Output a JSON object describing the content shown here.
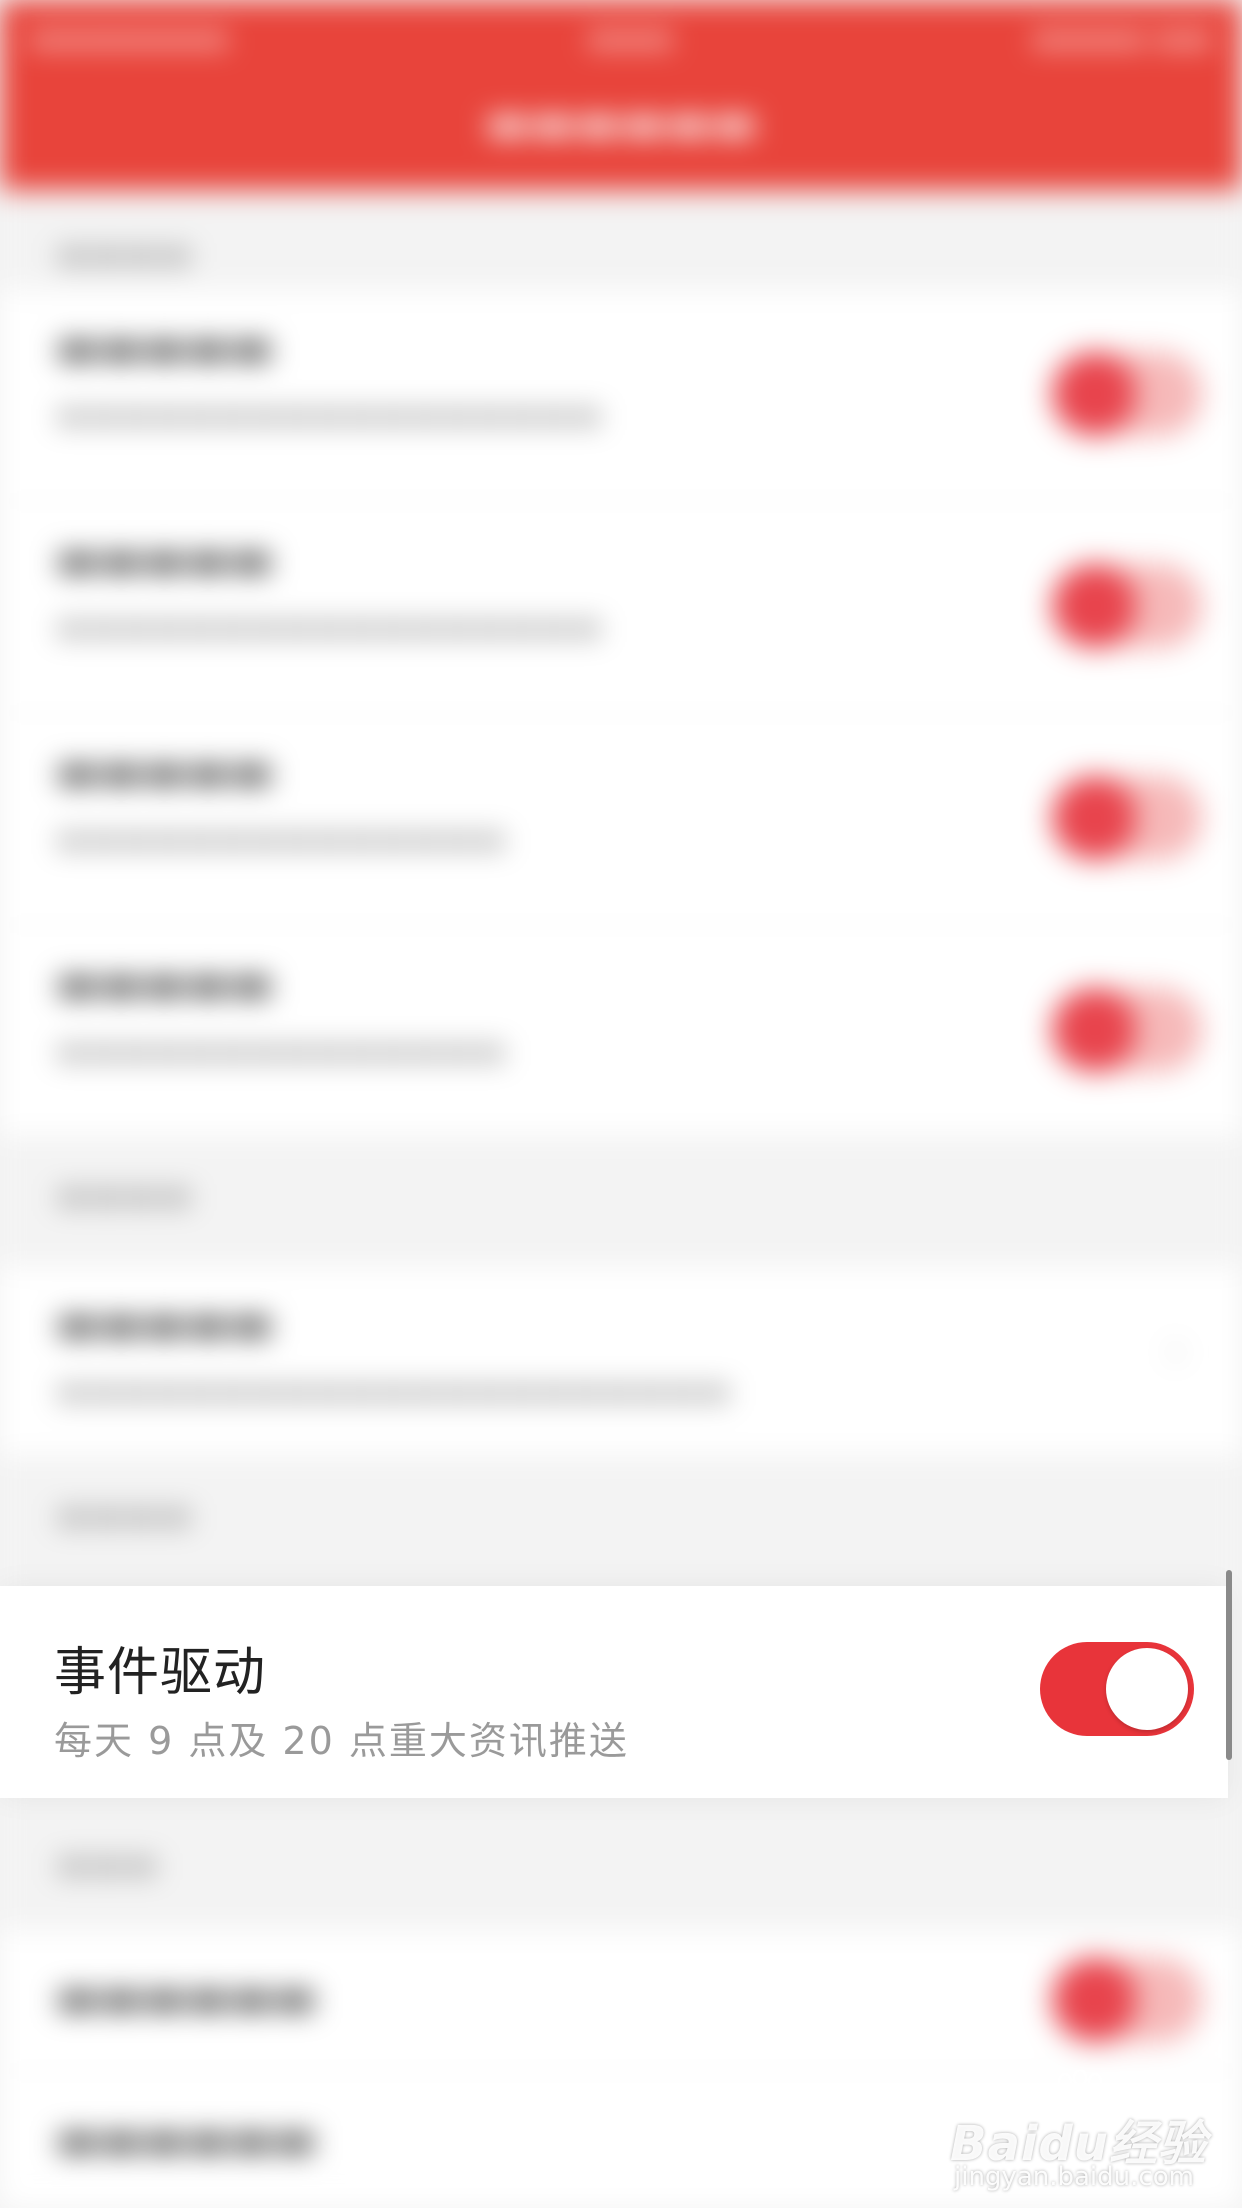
{
  "focused_setting": {
    "title": "事件驱动",
    "subtitle": "每天 9 点及 20 点重大资讯推送",
    "toggle_on": true,
    "accent_color": "#e8343a"
  },
  "watermark": {
    "logo_text": "Baidu经验",
    "url": "jingyan.baidu.com"
  },
  "colors": {
    "header": "#e8443b",
    "toggle_on": "#e8343a",
    "background": "#f3f3f3"
  },
  "icons": {
    "toggle": "toggle-switch-on",
    "watermark": "baidu-paw-icon"
  }
}
